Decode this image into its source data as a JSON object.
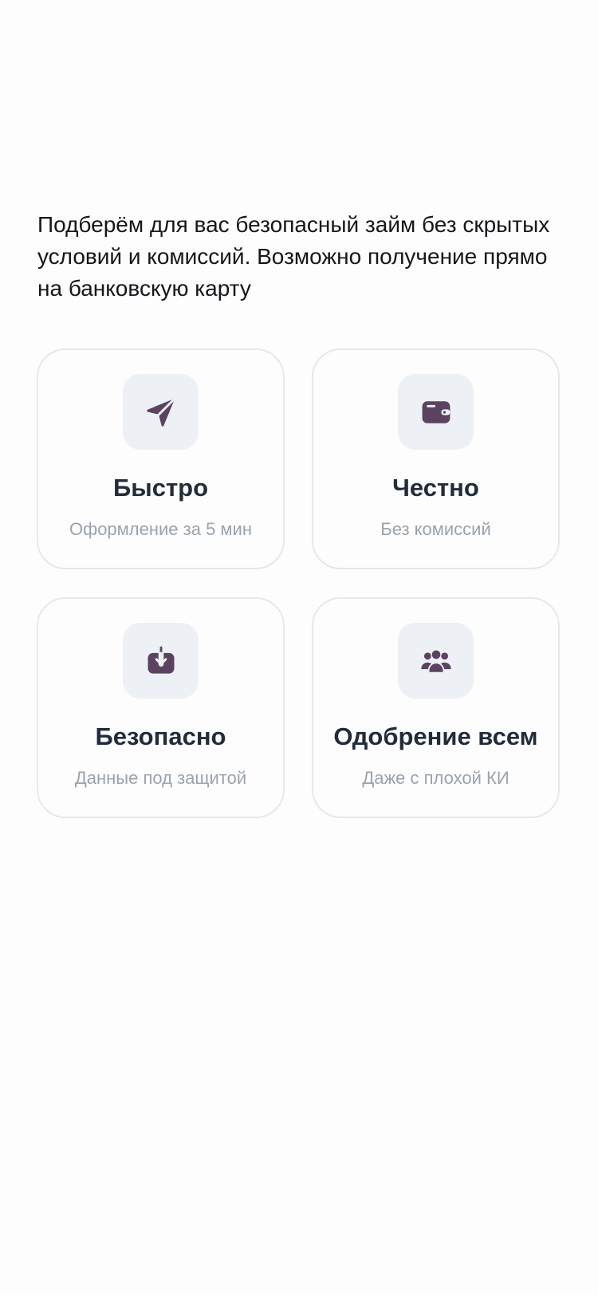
{
  "intro": {
    "text": "Подберём для вас безопасный займ без скрытых условий и комиссий. Возможно получение прямо на банковскую карту"
  },
  "colors": {
    "icon": "#5a4260",
    "icon_bg": "#edf1f6",
    "card_border": "#e6e8eb",
    "title": "#222c3a",
    "subtitle": "#9aa3ad"
  },
  "features": [
    {
      "icon": "paper-plane-icon",
      "title": "Быстро",
      "subtitle": "Оформление за 5 мин"
    },
    {
      "icon": "wallet-icon",
      "title": "Честно",
      "subtitle": "Без комиссий"
    },
    {
      "icon": "download-box-icon",
      "title": "Безопасно",
      "subtitle": "Данные под защитой"
    },
    {
      "icon": "users-group-icon",
      "title": "Одобрение всем",
      "subtitle": "Даже с плохой КИ"
    }
  ]
}
